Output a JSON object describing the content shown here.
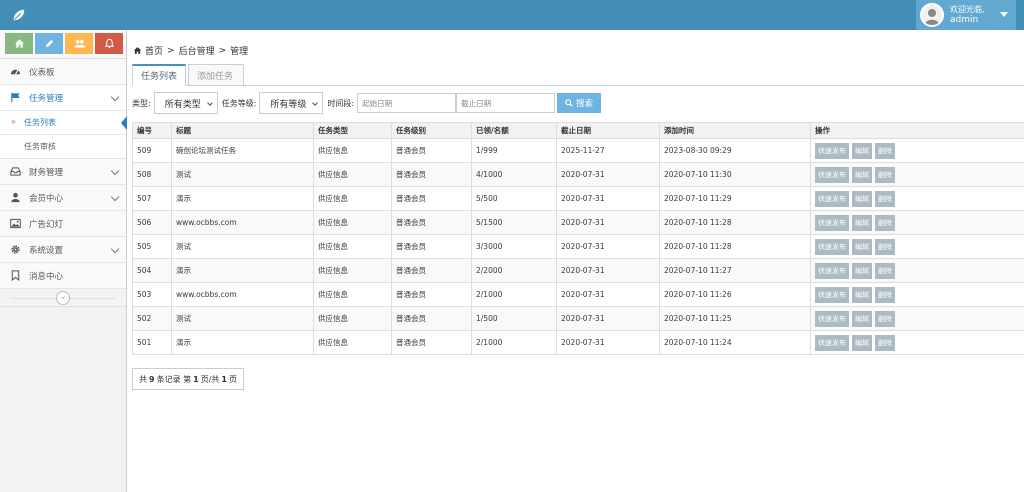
{
  "colors": {
    "topbar": "#438eb9",
    "accent": "#2b7dbc",
    "action_btn": "#abbac3",
    "search_btn": "#6fb3e0"
  },
  "header": {
    "logo_icon": "leaf-icon",
    "welcome": "欢迎光临,",
    "username": "admin"
  },
  "shortcuts": [
    {
      "icon": "home-icon",
      "color": "#87b87f"
    },
    {
      "icon": "pencil-icon",
      "color": "#6fb3e0"
    },
    {
      "icon": "users-icon",
      "color": "#ffb752"
    },
    {
      "icon": "bell-icon",
      "color": "#d15b47"
    }
  ],
  "sidebar": {
    "items": [
      {
        "label": "仪表板",
        "icon": "dashboard-icon"
      },
      {
        "label": "任务管理",
        "icon": "flag-icon"
      },
      {
        "label": "财务管理",
        "icon": "inbox-icon"
      },
      {
        "label": "会员中心",
        "icon": "user-icon"
      },
      {
        "label": "广告幻灯",
        "icon": "picture-icon"
      },
      {
        "label": "系统设置",
        "icon": "gear-icon"
      },
      {
        "label": "消息中心",
        "icon": "bookmark-icon"
      }
    ],
    "subitems": [
      {
        "label": "任务列表"
      },
      {
        "label": "任务审核"
      }
    ]
  },
  "breadcrumb": {
    "home": "首页",
    "sep": ">",
    "level2": "后台管理",
    "level3": "管理"
  },
  "tabs": [
    {
      "label": "任务列表"
    },
    {
      "label": "添加任务"
    }
  ],
  "filters": {
    "type_label": "类型:",
    "type_value": "所有类型",
    "level_label": "任务等级:",
    "level_value": "所有等级",
    "time_label": "时间段:",
    "start_placeholder": "起始日期",
    "end_placeholder": "截止日期",
    "search_label": "搜索"
  },
  "table": {
    "headers": [
      "编号",
      "标题",
      "任务类型",
      "任务级别",
      "已领/名额",
      "截止日期",
      "添加时间",
      "操作"
    ],
    "actions": [
      "快速发布",
      "编辑",
      "删除"
    ],
    "rows": [
      [
        "509",
        "碗创论坛测试任务",
        "供应信息",
        "普通会员",
        "1/999",
        "2025-11-27",
        "2023-08-30 09:29"
      ],
      [
        "508",
        "测试",
        "供应信息",
        "普通会员",
        "4/1000",
        "2020-07-31",
        "2020-07-10 11:30"
      ],
      [
        "507",
        "演示",
        "供应信息",
        "普通会员",
        "5/500",
        "2020-07-31",
        "2020-07-10 11:29"
      ],
      [
        "506",
        "www.ocbbs.com",
        "供应信息",
        "普通会员",
        "5/1500",
        "2020-07-31",
        "2020-07-10 11:28"
      ],
      [
        "505",
        "测试",
        "供应信息",
        "普通会员",
        "3/3000",
        "2020-07-31",
        "2020-07-10 11:28"
      ],
      [
        "504",
        "演示",
        "供应信息",
        "普通会员",
        "2/2000",
        "2020-07-31",
        "2020-07-10 11:27"
      ],
      [
        "503",
        "www.ocbbs.com",
        "供应信息",
        "普通会员",
        "2/1000",
        "2020-07-31",
        "2020-07-10 11:26"
      ],
      [
        "502",
        "测试",
        "供应信息",
        "普通会员",
        "1/500",
        "2020-07-31",
        "2020-07-10 11:25"
      ],
      [
        "501",
        "演示",
        "供应信息",
        "普通会员",
        "2/1000",
        "2020-07-31",
        "2020-07-10 11:24"
      ]
    ]
  },
  "pager": {
    "prefix": "共",
    "total": "9",
    "mid1": "条记录 第",
    "page": "1",
    "mid2": "页/共",
    "pages": "1",
    "suffix": "页"
  }
}
